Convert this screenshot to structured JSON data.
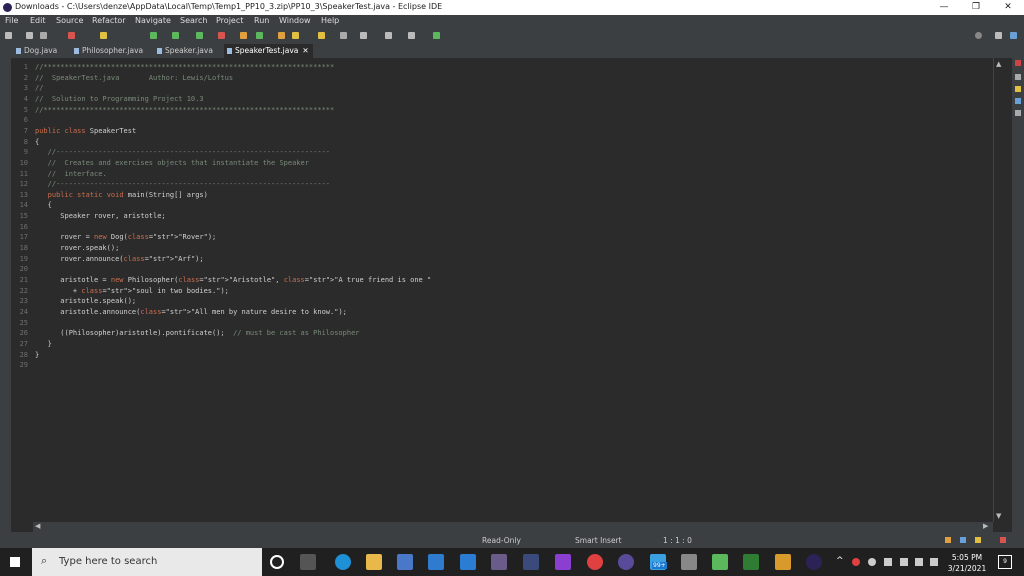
{
  "window": {
    "title": "Downloads - C:\\Users\\denze\\AppData\\Local\\Temp\\Temp1_PP10_3.zip\\PP10_3\\SpeakerTest.java - Eclipse IDE",
    "minimize": "—",
    "maximize": "❐",
    "close": "✕"
  },
  "menu": [
    "File",
    "Edit",
    "Source",
    "Refactor",
    "Navigate",
    "Search",
    "Project",
    "Run",
    "Window",
    "Help"
  ],
  "tabs": [
    "Dog.java",
    "Philosopher.java",
    "Speaker.java",
    "SpeakerTest.java"
  ],
  "tab_close": "✕",
  "code_lines": [
    "//*********************************************************************",
    "//  SpeakerTest.java       Author: Lewis/Loftus",
    "//",
    "//  Solution to Programming Project 10.3",
    "//*********************************************************************",
    "",
    "public class SpeakerTest",
    "{",
    "   //-----------------------------------------------------------------",
    "   //  Creates and exercises objects that instantiate the Speaker",
    "   //  interface.",
    "   //-----------------------------------------------------------------",
    "   public static void main(String[] args)",
    "   {",
    "      Speaker rover, aristotle;",
    "",
    "      rover = new Dog(\"Rover\");",
    "      rover.speak();",
    "      rover.announce(\"Arf\");",
    "",
    "      aristotle = new Philosopher(\"Aristotle\", \"A true friend is one \"",
    "         + \"soul in two bodies.\");",
    "      aristotle.speak();",
    "      aristotle.announce(\"All men by nature desire to know.\");",
    "",
    "      ((Philosopher)aristotle).pontificate();  // must be cast as Philosopher",
    "   }",
    "}",
    ""
  ],
  "status": {
    "mode": "Read-Only",
    "insert": "Smart Insert",
    "position": "1 : 1 : 0"
  },
  "taskbar": {
    "search_placeholder": "Type here to search",
    "time": "5:05 PM",
    "date": "3/21/2021",
    "badge": "99+",
    "notifications": "9"
  },
  "colors": {
    "editor_bg": "#2b2b2b",
    "keyword": "#cc6e4d",
    "string": "#6aab73",
    "comment": "#7a8a7a"
  }
}
